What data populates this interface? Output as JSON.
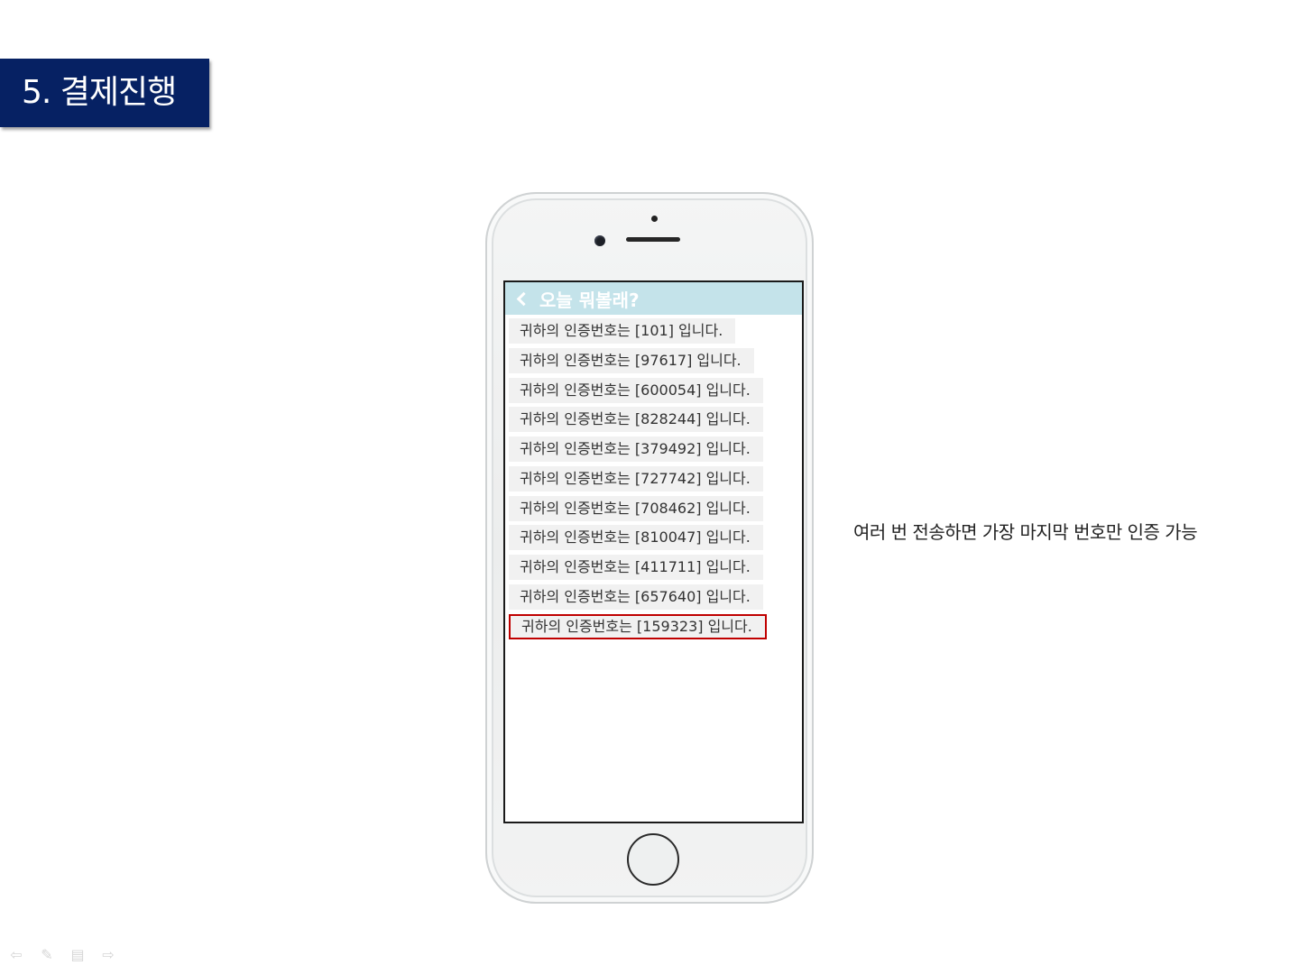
{
  "title": "5. 결제진행",
  "app": {
    "header_title": "오늘 뭐볼래?",
    "messages": [
      "귀하의 인증번호는 [101] 입니다.",
      "귀하의 인증번호는 [97617] 입니다.",
      "귀하의 인증번호는 [600054] 입니다.",
      "귀하의 인증번호는 [828244] 입니다.",
      "귀하의 인증번호는 [379492] 입니다.",
      "귀하의 인증번호는 [727742] 입니다.",
      "귀하의 인증번호는 [708462] 입니다.",
      "귀하의 인증번호는 [810047] 입니다.",
      "귀하의 인증번호는 [411711] 입니다.",
      "귀하의 인증번호는 [657640] 입니다.",
      "귀하의 인증번호는 [159323] 입니다."
    ],
    "highlighted_index": 10
  },
  "note": "여러 번 전송하면 가장 마지막 번호만 인증 가능",
  "controls": {
    "prev_icon": "arrow-left-icon",
    "pen_icon": "pen-icon",
    "menu_icon": "menu-icon",
    "next_icon": "arrow-right-icon"
  },
  "colors": {
    "banner": "#062163",
    "app_header": "#c4e3ea",
    "highlight_border": "#c00000",
    "bubble": "#f1f1f1"
  }
}
